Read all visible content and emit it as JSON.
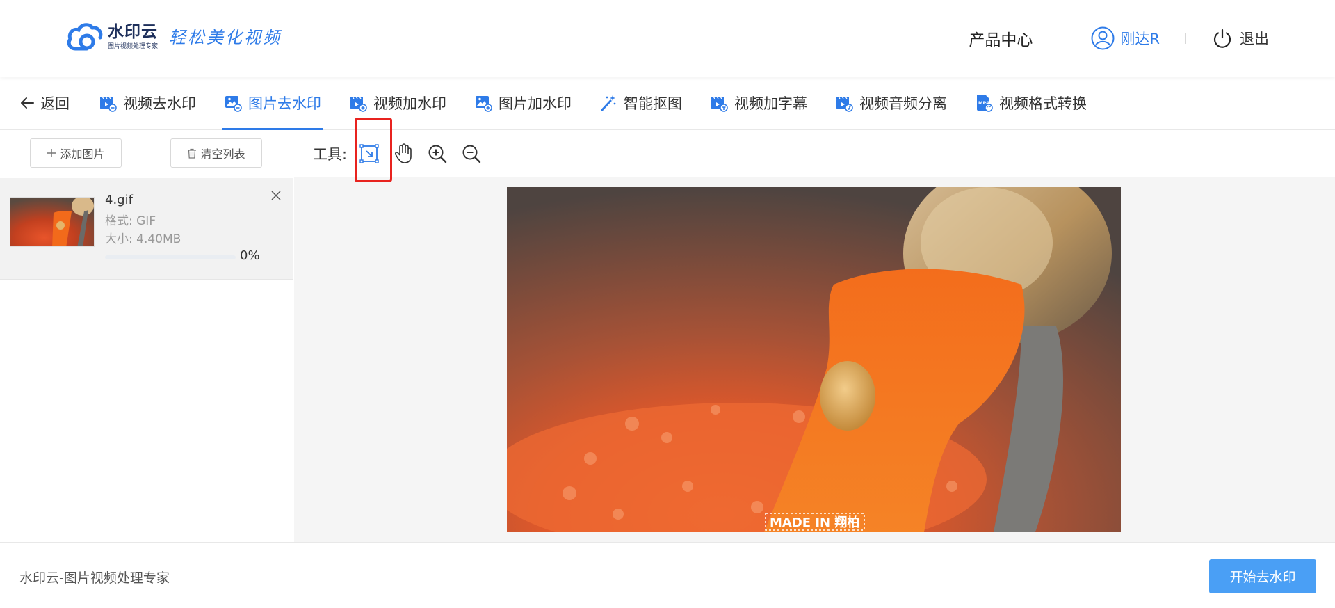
{
  "header": {
    "logo_name": "水印云",
    "logo_sub": "图片视频处理专家",
    "slogan": "轻松美化视频",
    "product_center": "产品中心",
    "username": "刚达R",
    "logout_label": "退出"
  },
  "tabs": {
    "back": "返回",
    "items": [
      {
        "label": "视频去水印",
        "icon": "video-remove-watermark-icon"
      },
      {
        "label": "图片去水印",
        "icon": "image-remove-watermark-icon",
        "active": true
      },
      {
        "label": "视频加水印",
        "icon": "video-add-watermark-icon"
      },
      {
        "label": "图片加水印",
        "icon": "image-add-watermark-icon"
      },
      {
        "label": "智能抠图",
        "icon": "magic-wand-icon"
      },
      {
        "label": "视频加字幕",
        "icon": "video-subtitle-icon"
      },
      {
        "label": "视频音频分离",
        "icon": "audio-separate-icon"
      },
      {
        "label": "视频格式转换",
        "icon": "mp4-format-icon"
      }
    ]
  },
  "left_panel": {
    "add_image": "添加图片",
    "clear_list": "清空列表",
    "file": {
      "name": "4.gif",
      "format": "格式: GIF",
      "size": "大小: 4.40MB",
      "progress_percent": 0,
      "progress_text": "0%"
    }
  },
  "tools": {
    "label": "工具:",
    "items": [
      "select-rect-icon",
      "hand-pan-icon",
      "zoom-in-icon",
      "zoom-out-icon"
    ],
    "active": "select-rect-icon"
  },
  "preview": {
    "watermark_text": "MADE IN 翔柏"
  },
  "footer": {
    "text": "水印云-图片视频处理专家",
    "start_button": "开始去水印"
  },
  "colors": {
    "accent": "#2e7be8",
    "primary_button": "#4a9ff5",
    "highlight": "#e8231f"
  }
}
